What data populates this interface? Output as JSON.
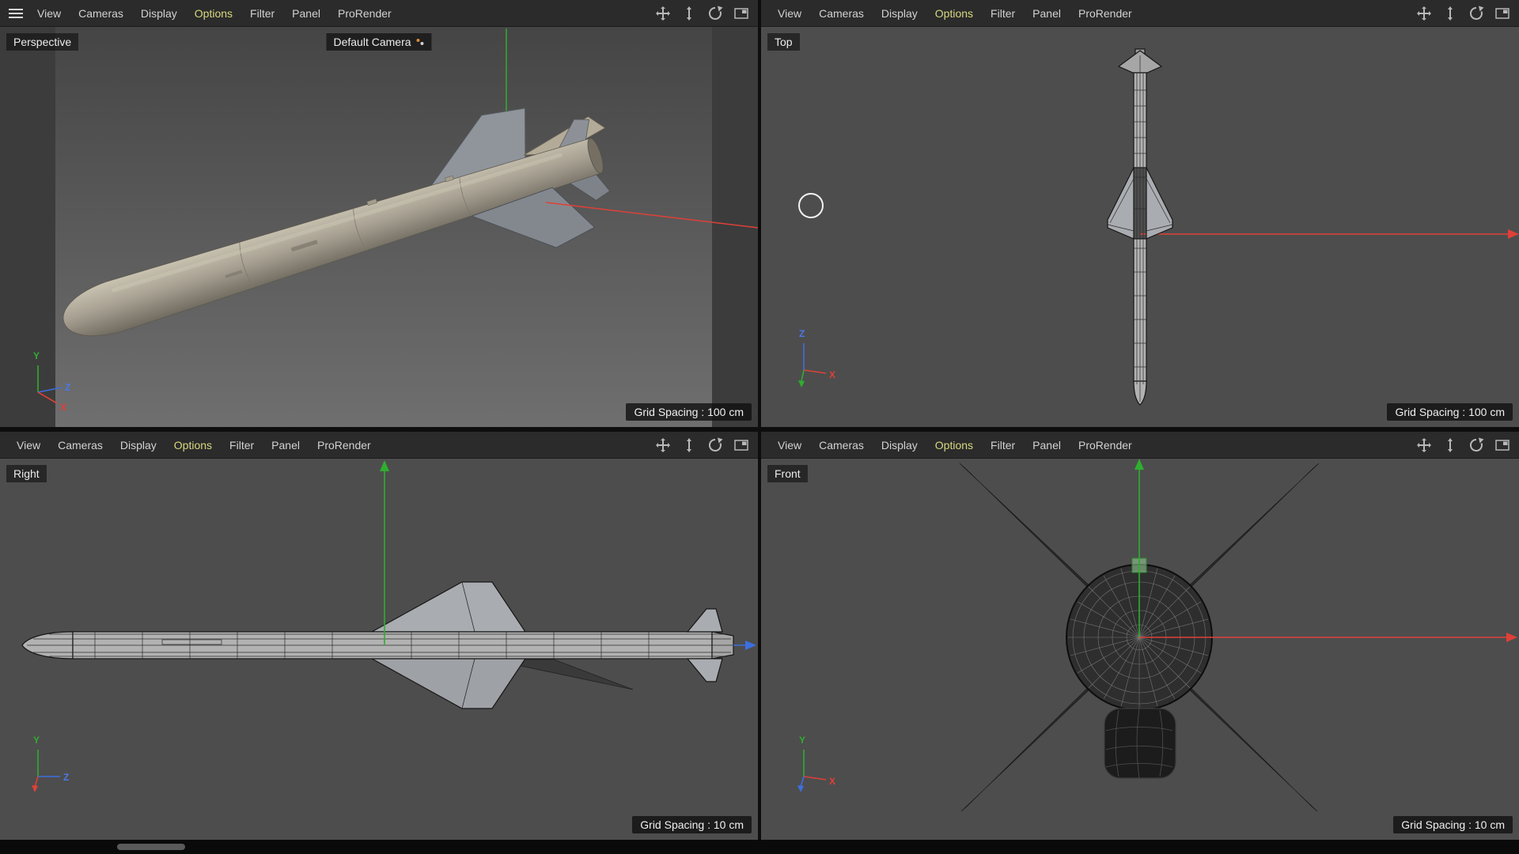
{
  "colors": {
    "menu_background": "#2b2b2b",
    "menu_text": "#d2d2d2",
    "menu_highlight_text": "#d8d880",
    "viewport_background": "#4d4d4d",
    "perspective_gradient_top": "#454545",
    "perspective_gradient_bottom": "#6f6f6f",
    "axis_x_red": "#e04038",
    "axis_y_green": "#2fae2f",
    "axis_z_blue": "#3d6fe0",
    "wireframe_fill": "#b2b2b2",
    "badge_background": "#141414"
  },
  "menu": {
    "items": [
      "View",
      "Cameras",
      "Display",
      "Options",
      "Filter",
      "Panel",
      "ProRender"
    ],
    "highlighted": "Options"
  },
  "axes": {
    "x": "X",
    "y": "Y",
    "z": "Z"
  },
  "viewports": {
    "perspective": {
      "label": "Perspective",
      "camera_label": "Default Camera",
      "grid_spacing": "Grid Spacing : 100 cm"
    },
    "top": {
      "label": "Top",
      "grid_spacing": "Grid Spacing : 100 cm"
    },
    "right": {
      "label": "Right",
      "grid_spacing": "Grid Spacing : 10 cm"
    },
    "front": {
      "label": "Front",
      "grid_spacing": "Grid Spacing : 10 cm"
    }
  }
}
